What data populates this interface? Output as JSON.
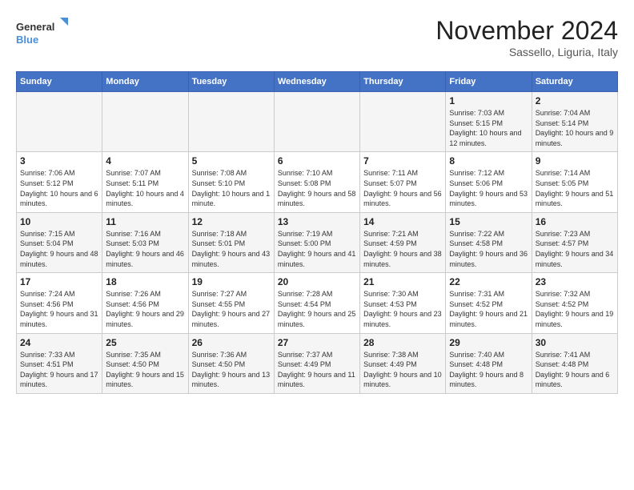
{
  "logo": {
    "line1": "General",
    "line2": "Blue"
  },
  "title": "November 2024",
  "subtitle": "Sassello, Liguria, Italy",
  "days_of_week": [
    "Sunday",
    "Monday",
    "Tuesday",
    "Wednesday",
    "Thursday",
    "Friday",
    "Saturday"
  ],
  "weeks": [
    [
      {
        "day": "",
        "info": ""
      },
      {
        "day": "",
        "info": ""
      },
      {
        "day": "",
        "info": ""
      },
      {
        "day": "",
        "info": ""
      },
      {
        "day": "",
        "info": ""
      },
      {
        "day": "1",
        "info": "Sunrise: 7:03 AM\nSunset: 5:15 PM\nDaylight: 10 hours and 12 minutes."
      },
      {
        "day": "2",
        "info": "Sunrise: 7:04 AM\nSunset: 5:14 PM\nDaylight: 10 hours and 9 minutes."
      }
    ],
    [
      {
        "day": "3",
        "info": "Sunrise: 7:06 AM\nSunset: 5:12 PM\nDaylight: 10 hours and 6 minutes."
      },
      {
        "day": "4",
        "info": "Sunrise: 7:07 AM\nSunset: 5:11 PM\nDaylight: 10 hours and 4 minutes."
      },
      {
        "day": "5",
        "info": "Sunrise: 7:08 AM\nSunset: 5:10 PM\nDaylight: 10 hours and 1 minute."
      },
      {
        "day": "6",
        "info": "Sunrise: 7:10 AM\nSunset: 5:08 PM\nDaylight: 9 hours and 58 minutes."
      },
      {
        "day": "7",
        "info": "Sunrise: 7:11 AM\nSunset: 5:07 PM\nDaylight: 9 hours and 56 minutes."
      },
      {
        "day": "8",
        "info": "Sunrise: 7:12 AM\nSunset: 5:06 PM\nDaylight: 9 hours and 53 minutes."
      },
      {
        "day": "9",
        "info": "Sunrise: 7:14 AM\nSunset: 5:05 PM\nDaylight: 9 hours and 51 minutes."
      }
    ],
    [
      {
        "day": "10",
        "info": "Sunrise: 7:15 AM\nSunset: 5:04 PM\nDaylight: 9 hours and 48 minutes."
      },
      {
        "day": "11",
        "info": "Sunrise: 7:16 AM\nSunset: 5:03 PM\nDaylight: 9 hours and 46 minutes."
      },
      {
        "day": "12",
        "info": "Sunrise: 7:18 AM\nSunset: 5:01 PM\nDaylight: 9 hours and 43 minutes."
      },
      {
        "day": "13",
        "info": "Sunrise: 7:19 AM\nSunset: 5:00 PM\nDaylight: 9 hours and 41 minutes."
      },
      {
        "day": "14",
        "info": "Sunrise: 7:21 AM\nSunset: 4:59 PM\nDaylight: 9 hours and 38 minutes."
      },
      {
        "day": "15",
        "info": "Sunrise: 7:22 AM\nSunset: 4:58 PM\nDaylight: 9 hours and 36 minutes."
      },
      {
        "day": "16",
        "info": "Sunrise: 7:23 AM\nSunset: 4:57 PM\nDaylight: 9 hours and 34 minutes."
      }
    ],
    [
      {
        "day": "17",
        "info": "Sunrise: 7:24 AM\nSunset: 4:56 PM\nDaylight: 9 hours and 31 minutes."
      },
      {
        "day": "18",
        "info": "Sunrise: 7:26 AM\nSunset: 4:56 PM\nDaylight: 9 hours and 29 minutes."
      },
      {
        "day": "19",
        "info": "Sunrise: 7:27 AM\nSunset: 4:55 PM\nDaylight: 9 hours and 27 minutes."
      },
      {
        "day": "20",
        "info": "Sunrise: 7:28 AM\nSunset: 4:54 PM\nDaylight: 9 hours and 25 minutes."
      },
      {
        "day": "21",
        "info": "Sunrise: 7:30 AM\nSunset: 4:53 PM\nDaylight: 9 hours and 23 minutes."
      },
      {
        "day": "22",
        "info": "Sunrise: 7:31 AM\nSunset: 4:52 PM\nDaylight: 9 hours and 21 minutes."
      },
      {
        "day": "23",
        "info": "Sunrise: 7:32 AM\nSunset: 4:52 PM\nDaylight: 9 hours and 19 minutes."
      }
    ],
    [
      {
        "day": "24",
        "info": "Sunrise: 7:33 AM\nSunset: 4:51 PM\nDaylight: 9 hours and 17 minutes."
      },
      {
        "day": "25",
        "info": "Sunrise: 7:35 AM\nSunset: 4:50 PM\nDaylight: 9 hours and 15 minutes."
      },
      {
        "day": "26",
        "info": "Sunrise: 7:36 AM\nSunset: 4:50 PM\nDaylight: 9 hours and 13 minutes."
      },
      {
        "day": "27",
        "info": "Sunrise: 7:37 AM\nSunset: 4:49 PM\nDaylight: 9 hours and 11 minutes."
      },
      {
        "day": "28",
        "info": "Sunrise: 7:38 AM\nSunset: 4:49 PM\nDaylight: 9 hours and 10 minutes."
      },
      {
        "day": "29",
        "info": "Sunrise: 7:40 AM\nSunset: 4:48 PM\nDaylight: 9 hours and 8 minutes."
      },
      {
        "day": "30",
        "info": "Sunrise: 7:41 AM\nSunset: 4:48 PM\nDaylight: 9 hours and 6 minutes."
      }
    ]
  ]
}
